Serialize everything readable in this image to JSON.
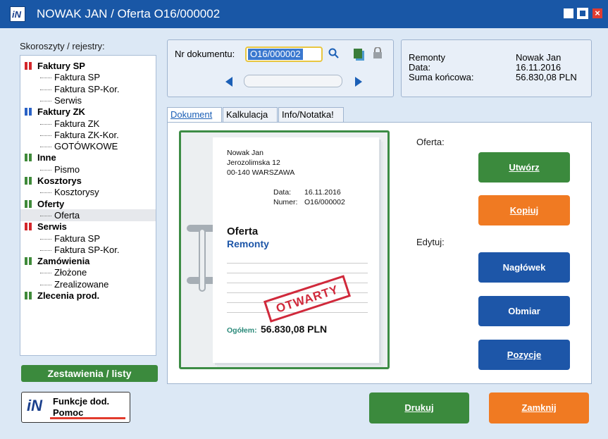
{
  "window": {
    "title": "NOWAK JAN / Oferta O16/000002"
  },
  "sidebar": {
    "label": "Skoroszyty / rejestry:",
    "items": [
      {
        "type": "group",
        "color": "red",
        "label": "Faktury SP"
      },
      {
        "type": "child",
        "label": "Faktura SP"
      },
      {
        "type": "child",
        "label": "Faktura SP-Kor."
      },
      {
        "type": "child",
        "label": "Serwis"
      },
      {
        "type": "group",
        "color": "blue",
        "label": "Faktury ZK"
      },
      {
        "type": "child",
        "label": "Faktura ZK"
      },
      {
        "type": "child",
        "label": "Faktura ZK-Kor."
      },
      {
        "type": "child",
        "label": "GOTÓWKOWE"
      },
      {
        "type": "group",
        "color": "green",
        "label": "Inne"
      },
      {
        "type": "child",
        "label": "Pismo"
      },
      {
        "type": "group",
        "color": "green",
        "label": "Kosztorys"
      },
      {
        "type": "child",
        "label": "Kosztorysy"
      },
      {
        "type": "group",
        "color": "green",
        "label": "Oferty"
      },
      {
        "type": "child",
        "label": "Oferta",
        "selected": true
      },
      {
        "type": "group",
        "color": "red",
        "label": "Serwis"
      },
      {
        "type": "child",
        "label": "Faktura SP"
      },
      {
        "type": "child",
        "label": "Faktura SP-Kor."
      },
      {
        "type": "group",
        "color": "green",
        "label": "Zamówienia"
      },
      {
        "type": "child",
        "label": "Złożone"
      },
      {
        "type": "child",
        "label": "Zrealizowane"
      },
      {
        "type": "group",
        "color": "green",
        "label": "Zlecenia prod."
      }
    ],
    "reports_button": "Zestawienia / listy",
    "functions_button": {
      "line1": "Funkcje dod.",
      "line2": "Pomoc"
    }
  },
  "document": {
    "nr_label": "Nr dokumentu:",
    "nr_value": "O16/000002"
  },
  "info": {
    "rows": [
      {
        "label": "Remonty",
        "value": "Nowak Jan"
      },
      {
        "label": "Data:",
        "value": "16.11.2016"
      },
      {
        "label": "Suma końcowa:",
        "value": "56.830,08 PLN"
      }
    ]
  },
  "tabs": [
    "Dokument",
    "Kalkulacja",
    "Info/Notatka!"
  ],
  "preview": {
    "client_name": "Nowak Jan",
    "client_street": "Jerozolimska 12",
    "client_city": "00-140 WARSZAWA",
    "date_label": "Data:",
    "date_value": "16.11.2016",
    "number_label": "Numer:",
    "number_value": "O16/000002",
    "doc_title": "Oferta",
    "doc_subtitle": "Remonty",
    "stamp": "OTWARTY",
    "total_label": "Ogółem:",
    "total_value": "56.830,08 PLN"
  },
  "actions": {
    "oferta_label": "Oferta:",
    "create": "Utwórz",
    "copy": "Kopiuj",
    "edit_label": "Edytuj:",
    "header": "Nagłówek",
    "measure": "Obmiar",
    "positions": "Pozycje"
  },
  "bottom": {
    "print": "Drukuj",
    "close": "Zamknij"
  }
}
